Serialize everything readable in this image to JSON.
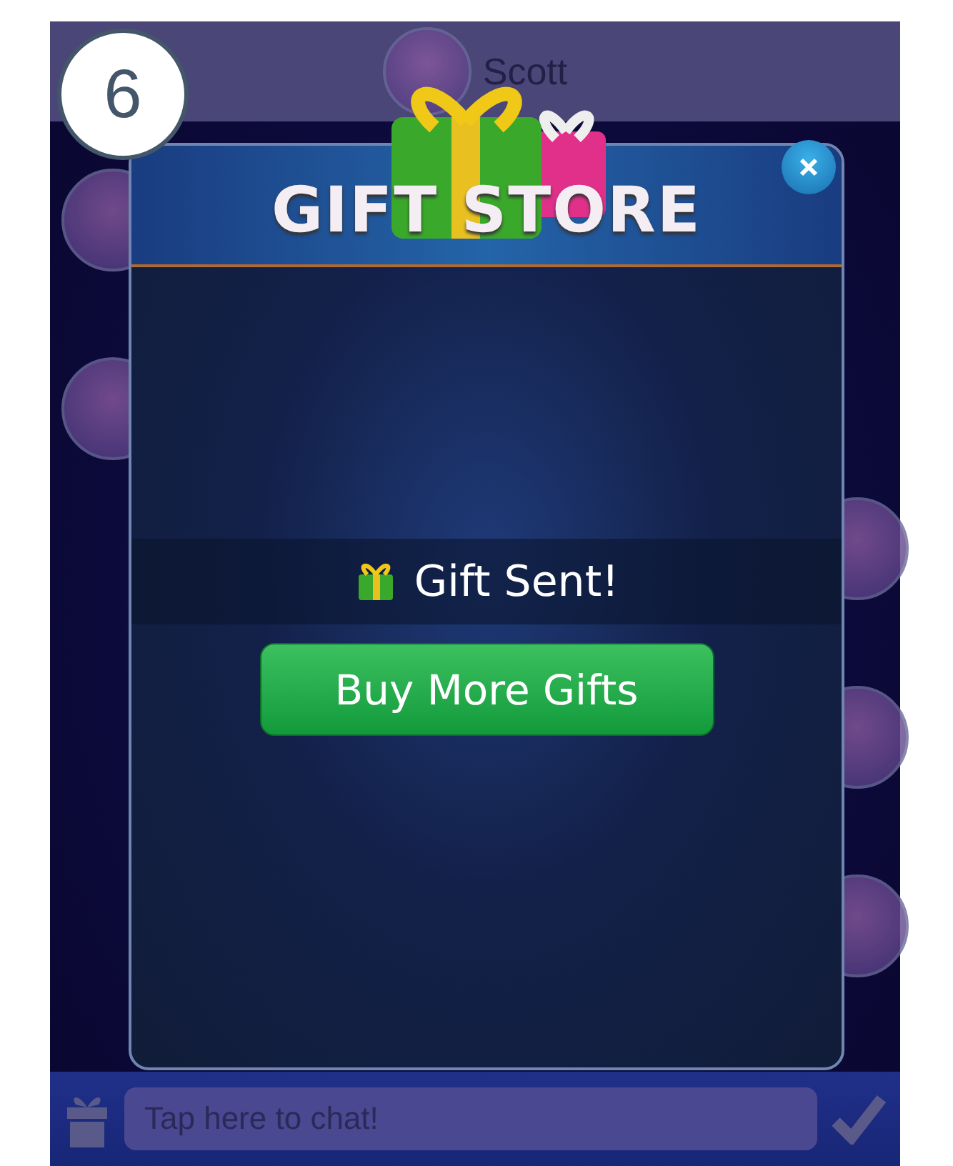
{
  "step_badge": "6",
  "header": {
    "name": "Scott"
  },
  "dialog": {
    "title": "GIFT STORE",
    "status": "Gift Sent!",
    "button": "Buy More Gifts"
  },
  "chat_bar": {
    "placeholder": "Tap here to chat!"
  }
}
